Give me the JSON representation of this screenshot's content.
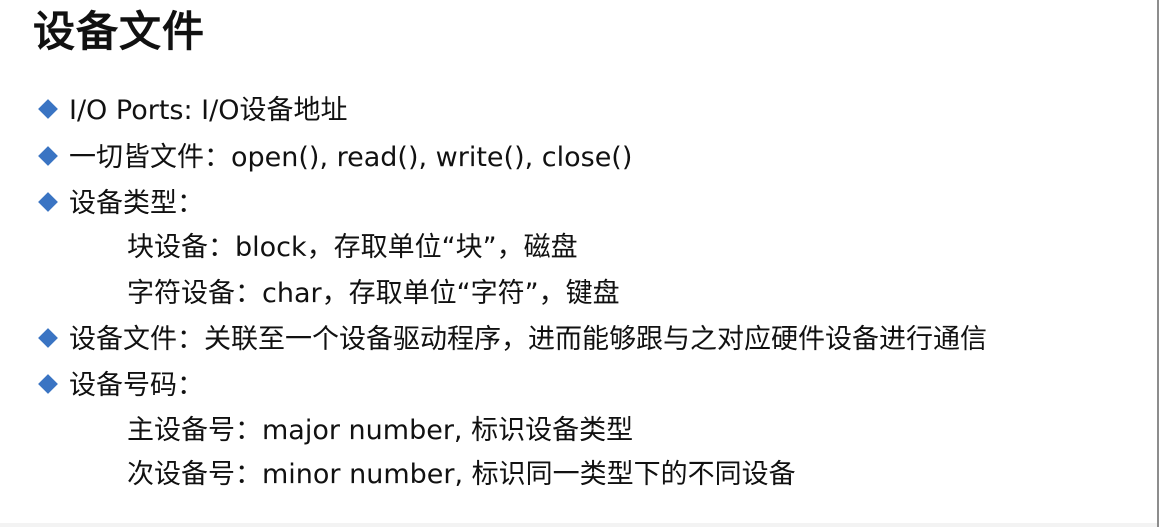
{
  "slide": {
    "title": "设备文件",
    "accent_color": "#3a74c3",
    "bullet_icon": "diamond-bullet-icon",
    "items": [
      {
        "text": "I/O Ports: I/O设备地址"
      },
      {
        "text": "一切皆文件：open(), read(), write(), close()"
      },
      {
        "text": "设备类型："
      },
      {
        "text": "块设备：block，存取单位“块”，磁盘"
      },
      {
        "text": "字符设备：char，存取单位“字符”，键盘"
      },
      {
        "text": "设备文件：关联至一个设备驱动程序，进而能够跟与之对应硬件设备进行通信"
      },
      {
        "text": "设备号码："
      },
      {
        "text": "主设备号：major number, 标识设备类型"
      },
      {
        "text": "次设备号：minor number, 标识同一类型下的不同设备"
      }
    ]
  }
}
